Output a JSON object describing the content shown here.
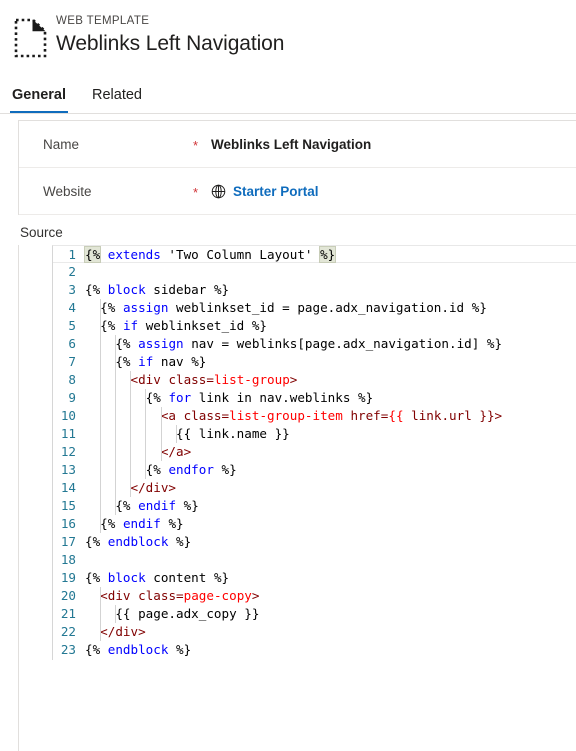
{
  "header": {
    "icon": "web-template-document-icon",
    "eyebrow": "WEB TEMPLATE",
    "title": "Weblinks Left Navigation"
  },
  "tabs": [
    {
      "label": "General",
      "active": true
    },
    {
      "label": "Related",
      "active": false
    }
  ],
  "form": {
    "rows": [
      {
        "label": "Name",
        "required": "*",
        "value": "Weblinks Left Navigation",
        "type": "text"
      },
      {
        "label": "Website",
        "required": "*",
        "value": "Starter Portal",
        "type": "lookup",
        "icon": "globe-icon"
      }
    ]
  },
  "source": {
    "label": "Source",
    "language": "liquid-html",
    "line_count": 23,
    "lines": [
      {
        "n": "1",
        "text": "{% extends 'Two Column Layout' %}"
      },
      {
        "n": "2",
        "text": ""
      },
      {
        "n": "3",
        "text": "{% block sidebar %}"
      },
      {
        "n": "4",
        "text": "  {% assign weblinkset_id = page.adx_navigation.id %}"
      },
      {
        "n": "5",
        "text": "  {% if weblinkset_id %}"
      },
      {
        "n": "6",
        "text": "    {% assign nav = weblinks[page.adx_navigation.id] %}"
      },
      {
        "n": "7",
        "text": "    {% if nav %}"
      },
      {
        "n": "8",
        "text": "      <div class=list-group>"
      },
      {
        "n": "9",
        "text": "        {% for link in nav.weblinks %}"
      },
      {
        "n": "10",
        "text": "          <a class=list-group-item href={{ link.url }}>"
      },
      {
        "n": "11",
        "text": "            {{ link.name }}"
      },
      {
        "n": "12",
        "text": "          </a>"
      },
      {
        "n": "13",
        "text": "        {% endfor %}"
      },
      {
        "n": "14",
        "text": "      </div>"
      },
      {
        "n": "15",
        "text": "    {% endif %}"
      },
      {
        "n": "16",
        "text": "  {% endif %}"
      },
      {
        "n": "17",
        "text": "{% endblock %}"
      },
      {
        "n": "18",
        "text": ""
      },
      {
        "n": "19",
        "text": "{% block content %}"
      },
      {
        "n": "20",
        "text": "  <div class=page-copy>"
      },
      {
        "n": "21",
        "text": "    {{ page.adx_copy }}"
      },
      {
        "n": "22",
        "text": "  </div>"
      },
      {
        "n": "23",
        "text": "{% endblock %}"
      }
    ]
  },
  "colors": {
    "accent": "#0f6cbd",
    "required": "#d13438",
    "line_number": "#237893",
    "keyword": "#0000ff",
    "tag": "#800000",
    "attribute_value": "#ff0000",
    "text": "#000000",
    "border": "#e1dfdd"
  }
}
